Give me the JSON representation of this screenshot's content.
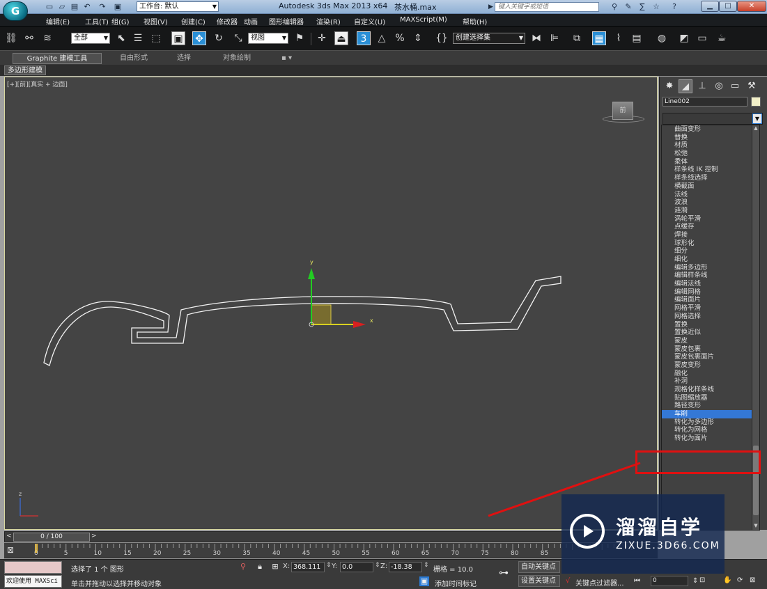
{
  "titlebar": {
    "workspace_label": "工作台: 默认",
    "app_title": "Autodesk 3ds Max  2013 x64",
    "file_name": "茶水桶.max",
    "search_placeholder": "键入关键字或短语",
    "app_logo": "G"
  },
  "menu": [
    "编辑(E)",
    "工具(T)",
    "组(G)",
    "视图(V)",
    "创建(C)",
    "修改器",
    "动画",
    "图形编辑器",
    "渲染(R)",
    "自定义(U)",
    "MAXScript(M)",
    "帮助(H)"
  ],
  "toolbar": {
    "selection_filter": "全部",
    "coord_system": "视图",
    "named_selection": "创建选择集",
    "snap_label": "3"
  },
  "ribbon": {
    "tabs": [
      "Graphite 建模工具",
      "自由形式",
      "选择",
      "对象绘制"
    ],
    "subtab": "多边形建模"
  },
  "viewport": {
    "label": "[+][前][真实 + 边面]",
    "viewcube_label": "前",
    "axis_x": "x",
    "axis_y": "y",
    "axis_z": "z"
  },
  "command_panel": {
    "object_name": "Line002",
    "modifiers": [
      "曲面变形",
      "替换",
      "材质",
      "松弛",
      "柔体",
      "样条线 IK 控制",
      "样条线选择",
      "横截面",
      "法线",
      "波浪",
      "涟漪",
      "涡轮平滑",
      "点缓存",
      "焊接",
      "球形化",
      "细分",
      "细化",
      "编辑多边形",
      "编辑样条线",
      "编辑法线",
      "编辑网格",
      "编辑面片",
      "网格平滑",
      "网格选择",
      "置换",
      "置换近似",
      "蒙皮",
      "蒙皮包裹",
      "蒙皮包裹面片",
      "蒙皮变形",
      "融化",
      "补洞",
      "规格化样条线",
      "贴图缩放器",
      "路径变形",
      "车削",
      "转化为多边形",
      "转化为网格",
      "转化为面片"
    ],
    "selected_modifier": "车削"
  },
  "timeline": {
    "slider_label": "0 / 100",
    "ticks": [
      "0",
      "5",
      "10",
      "15",
      "20",
      "25",
      "30",
      "35",
      "40",
      "45",
      "50",
      "55",
      "60",
      "65",
      "70",
      "75",
      "80",
      "85"
    ]
  },
  "status": {
    "welcome": "欢迎使用 MAXSci",
    "selection_info": "选择了 1 个 图形",
    "prompt": "单击并拖动以选择并移动对象",
    "x_label": "X:",
    "x_value": "368.111",
    "y_label": "Y:",
    "y_value": "0.0",
    "z_label": "Z:",
    "z_value": "-18.38",
    "grid": "栅格 = 10.0",
    "add_time_tag": "添加时间标记",
    "auto_key": "自动关键点",
    "set_key": "设置关键点",
    "key_filters": "关键点过滤器...",
    "frame_value": "0"
  },
  "watermark": {
    "title": "溜溜自学",
    "url": "ZIXUE.3D66.COM"
  },
  "colors": {
    "viewport_bg": "#444444",
    "selection_highlight": "#3478d6",
    "annotation_red": "#e01010",
    "gizmo_yellow": "#c9b43a"
  }
}
